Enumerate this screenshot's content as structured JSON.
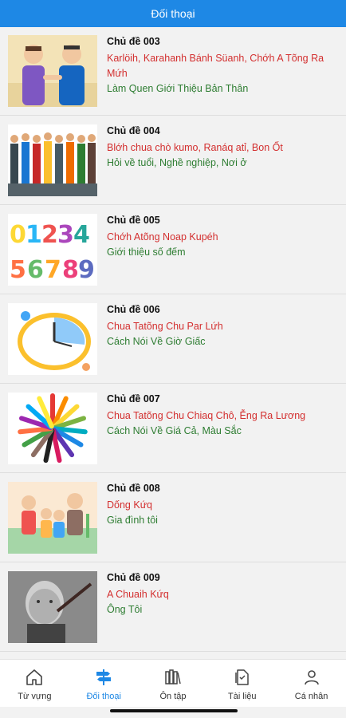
{
  "header": {
    "title": "Đối thoại"
  },
  "topics": [
    {
      "title": "Chủ đề 003",
      "local": "Karlöih, Karahanh Bánh Süanh, Chớh A Tõng Ra Mứh",
      "viet": "Làm Quen Giới Thiệu Bản Thân",
      "image": "two-men-greeting"
    },
    {
      "title": "Chủ đề 004",
      "local": "Blớh chua chò kumo, Ranáq atỉ, Bon Ốt",
      "viet": "Hỏi về tuổi, Nghề nghiệp, Nơi ở",
      "image": "group-of-workers"
    },
    {
      "title": "Chủ đề 005",
      "local": "Chớh Atõng Noap Kupéh",
      "viet": "Giới thiệu số đếm",
      "image": "colorful-numbers"
    },
    {
      "title": "Chủ đề 006",
      "local": "Chua Tatõng Chu Par Lứh",
      "viet": "Cách Nói Về Giờ Giấc",
      "image": "clock"
    },
    {
      "title": "Chủ đề 007",
      "local": "Chua Tatõng Chu Chiaq Chô, Ễng Ra Lương",
      "viet": "Cách Nói Về Giá Cả, Màu Sắc",
      "image": "color-fan"
    },
    {
      "title": "Chủ đề 008",
      "local": "Dống Kứq",
      "viet": "Gia đình tôi",
      "image": "family"
    },
    {
      "title": "Chủ đề 009",
      "local": "A Chuaih Kứq",
      "viet": "Ông Tôi",
      "image": "old-man"
    }
  ],
  "tabs": [
    {
      "label": "Từ vựng",
      "icon": "home-icon"
    },
    {
      "label": "Đối thoại",
      "icon": "signpost-icon",
      "active": true
    },
    {
      "label": "Ôn tập",
      "icon": "books-icon"
    },
    {
      "label": "Tài liệu",
      "icon": "document-icon"
    },
    {
      "label": "Cá nhân",
      "icon": "person-icon"
    }
  ],
  "colors": {
    "accent": "#1e88e5",
    "local_text": "#d32f2f",
    "viet_text": "#2e7d32"
  }
}
